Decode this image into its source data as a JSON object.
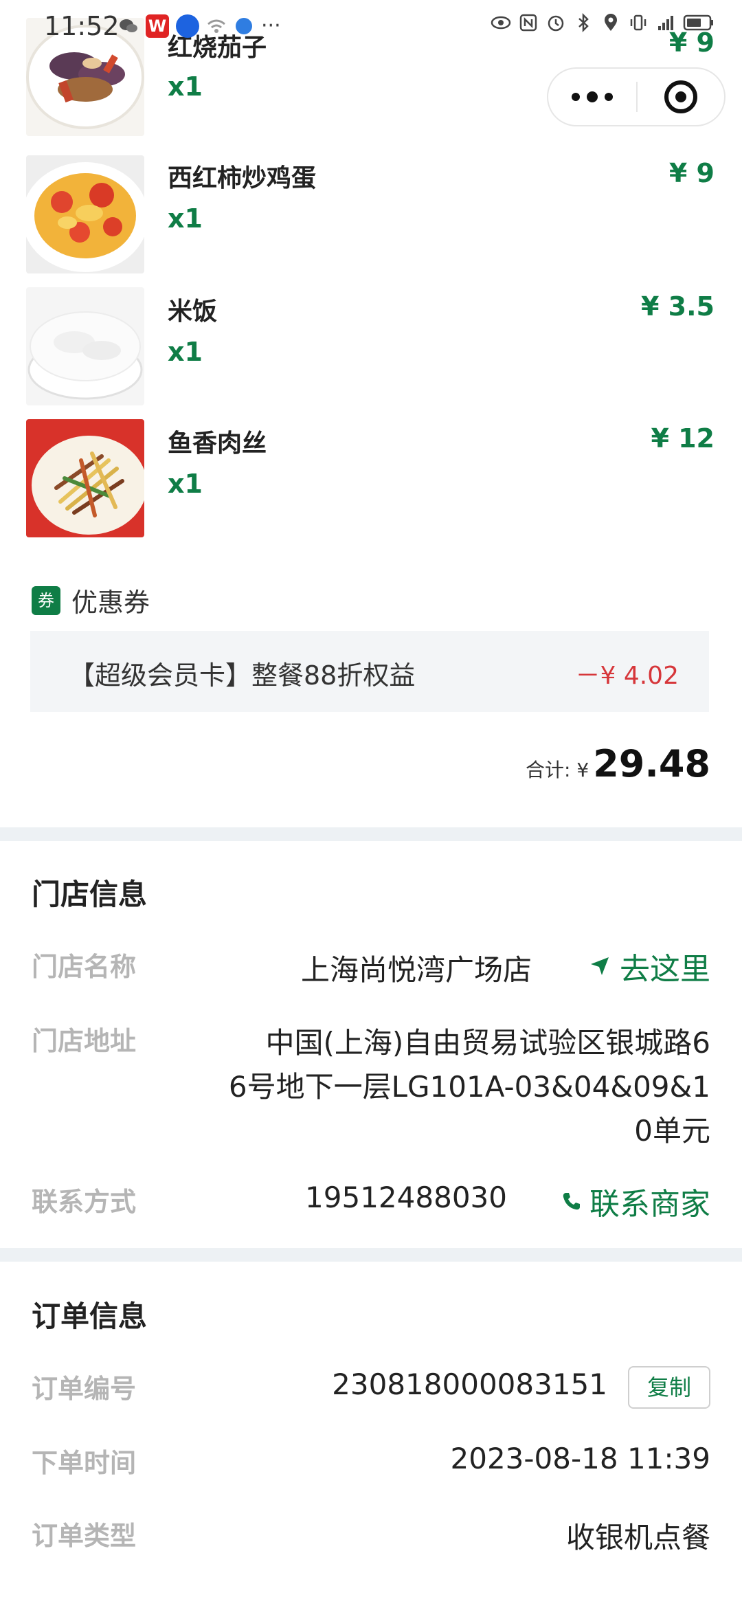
{
  "status_bar": {
    "time": "11:52",
    "left_icons": [
      "wechat-icon",
      "wps-icon",
      "bulb-icon",
      "wifi-off-icon",
      "browser-icon"
    ],
    "more": "···",
    "right_icons": [
      "eye-icon",
      "nfc-icon",
      "alarm-icon",
      "bluetooth-icon",
      "location-icon",
      "vibrate-icon",
      "signal-icon",
      "battery-icon"
    ],
    "network": "4G"
  },
  "capsule": {
    "more_icon": "more-dots-icon",
    "close_icon": "target-close-icon"
  },
  "items": [
    {
      "name": "红烧茄子",
      "qty": "x1",
      "price": "¥ 9",
      "image": "eggplant"
    },
    {
      "name": "西红柿炒鸡蛋",
      "qty": "x1",
      "price": "¥ 9",
      "image": "tomato-egg"
    },
    {
      "name": "米饭",
      "qty": "x1",
      "price": "¥ 3.5",
      "image": "rice"
    },
    {
      "name": "鱼香肉丝",
      "qty": "x1",
      "price": "¥ 12",
      "image": "shredded-pork"
    }
  ],
  "coupon": {
    "tag": "券",
    "label": "优惠券",
    "name": "【超级会员卡】整餐88折权益",
    "amount": "－¥ 4.02"
  },
  "total": {
    "label": "合计: ¥",
    "value": "29.48"
  },
  "store": {
    "title": "门店信息",
    "name_label": "门店名称",
    "name_value": "上海尚悦湾广场店",
    "navigate_label": "去这里",
    "address_label": "门店地址",
    "address_lines": [
      "中国(上海)自由贸易试验区银城路6",
      "6号地下一层LG101A-03&04&09&1",
      "0单元"
    ],
    "contact_label": "联系方式",
    "contact_value": "19512488030",
    "call_label": "联系商家"
  },
  "order": {
    "title": "订单信息",
    "number_label": "订单编号",
    "number_value": "230818000083151",
    "copy_label": "复制",
    "time_label": "下单时间",
    "time_value": "2023-08-18 11:39",
    "type_label": "订单类型",
    "type_value": "收银机点餐"
  },
  "colors": {
    "accent": "#0f7d46",
    "discount": "#d6363a",
    "label_gray": "#b5b5b5"
  }
}
